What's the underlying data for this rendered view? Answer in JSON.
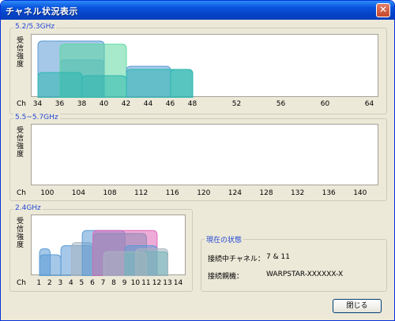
{
  "window": {
    "title": "チャネル状況表示",
    "close_glyph": "✕"
  },
  "band52": {
    "label": "5.2/5.3GHz",
    "ylabel": [
      "受",
      "信",
      "強",
      "度"
    ],
    "ch_label": "Ch",
    "ticks": [
      "34",
      "36",
      "38",
      "40",
      "42",
      "44",
      "46",
      "48",
      "52",
      "56",
      "60",
      "64"
    ]
  },
  "band55": {
    "label": "5.5~5.7GHz",
    "ylabel": [
      "受",
      "信",
      "強",
      "度"
    ],
    "ch_label": "Ch",
    "ticks": [
      "100",
      "104",
      "108",
      "112",
      "116",
      "120",
      "124",
      "128",
      "132",
      "136",
      "140"
    ]
  },
  "band24": {
    "label": "2.4GHz",
    "ylabel": [
      "受",
      "信",
      "強",
      "度"
    ],
    "ch_label": "Ch",
    "ticks": [
      "1",
      "2",
      "3",
      "4",
      "5",
      "6",
      "7",
      "8",
      "9",
      "10",
      "11",
      "12",
      "13",
      "14"
    ]
  },
  "status": {
    "legend": "現在の状態",
    "channel_label": "接続中チャネル：",
    "channel_value": "7 & 11",
    "device_label": "接続親機：",
    "device_value": "WARPSTAR-XXXXXX-X"
  },
  "buttons": {
    "close_label": "閉じる"
  },
  "colors": {
    "blue": "#5b9bd5",
    "teal": "#2eb7b0",
    "green": "#5fd8a0",
    "pink": "#e066b8",
    "gray": "#a8b4c0"
  },
  "chart_data": [
    {
      "type": "area",
      "title": "5.2/5.3GHz",
      "ylabel": "受信強度",
      "xlabel": "Ch",
      "categories": [
        "34",
        "36",
        "38",
        "40",
        "42",
        "44",
        "46",
        "48",
        "52",
        "56",
        "60",
        "64"
      ],
      "series": [
        {
          "x_from": "34",
          "x_to": "40",
          "level": 0.9,
          "color": "blue"
        },
        {
          "x_from": "36",
          "x_to": "40",
          "level": 0.6,
          "color": "blue"
        },
        {
          "x_from": "36",
          "x_to": "42",
          "level": 0.85,
          "color": "green"
        },
        {
          "x_from": "34",
          "x_to": "38",
          "level": 0.4,
          "color": "teal"
        },
        {
          "x_from": "38",
          "x_to": "42",
          "level": 0.35,
          "color": "teal"
        },
        {
          "x_from": "42",
          "x_to": "46",
          "level": 0.5,
          "color": "blue"
        },
        {
          "x_from": "42",
          "x_to": "48",
          "level": 0.45,
          "color": "teal"
        },
        {
          "x_from": "46",
          "x_to": "48",
          "level": 0.45,
          "color": "teal"
        }
      ]
    },
    {
      "type": "area",
      "title": "5.5~5.7GHz",
      "ylabel": "受信強度",
      "xlabel": "Ch",
      "categories": [
        "100",
        "104",
        "108",
        "112",
        "116",
        "120",
        "124",
        "128",
        "132",
        "136",
        "140"
      ],
      "series": []
    },
    {
      "type": "area",
      "title": "2.4GHz",
      "ylabel": "受信強度",
      "xlabel": "Ch",
      "categories": [
        "1",
        "2",
        "3",
        "4",
        "5",
        "6",
        "7",
        "8",
        "9",
        "10",
        "11",
        "12",
        "13",
        "14"
      ],
      "series": [
        {
          "x_from": "1",
          "x_to": "2",
          "level": 0.45,
          "color": "blue"
        },
        {
          "x_from": "1",
          "x_to": "3",
          "level": 0.35,
          "color": "blue"
        },
        {
          "x_from": "3",
          "x_to": "6",
          "level": 0.5,
          "color": "blue"
        },
        {
          "x_from": "4",
          "x_to": "6",
          "level": 0.55,
          "color": "gray"
        },
        {
          "x_from": "5",
          "x_to": "9",
          "level": 0.75,
          "color": "blue"
        },
        {
          "x_from": "6",
          "x_to": "11",
          "level": 0.7,
          "color": "teal"
        },
        {
          "x_from": "6",
          "x_to": "12",
          "level": 0.75,
          "color": "pink"
        },
        {
          "x_from": "9",
          "x_to": "12",
          "level": 0.5,
          "color": "blue"
        },
        {
          "x_from": "9",
          "x_to": "13",
          "level": 0.4,
          "color": "teal"
        },
        {
          "x_from": "10",
          "x_to": "13",
          "level": 0.45,
          "color": "gray"
        },
        {
          "x_from": "7",
          "x_to": "11",
          "level": 0.4,
          "color": "gray"
        }
      ]
    }
  ]
}
